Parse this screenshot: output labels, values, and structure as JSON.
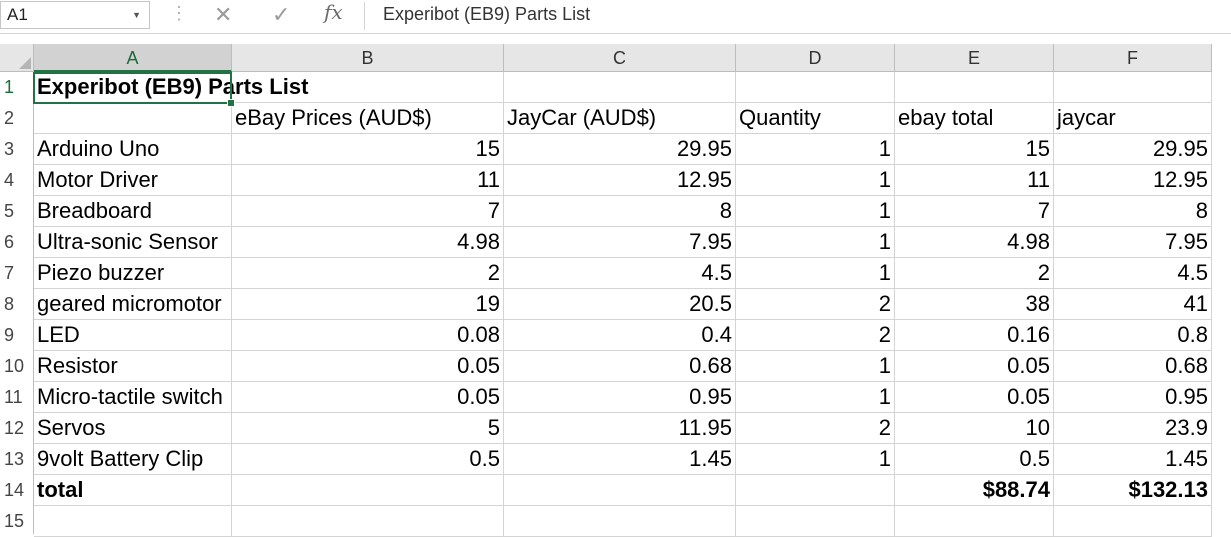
{
  "formula_bar": {
    "name_box": "A1",
    "content": "Experibot (EB9) Parts List",
    "cancel_symbol": "✕",
    "enter_symbol": "✓",
    "fx_label": "fx"
  },
  "columns": [
    "A",
    "B",
    "C",
    "D",
    "E",
    "F"
  ],
  "rows": [
    {
      "num": "1",
      "cells": [
        "Experibot (EB9) Parts List",
        "",
        "",
        "",
        "",
        ""
      ]
    },
    {
      "num": "2",
      "cells": [
        "",
        "eBay Prices (AUD$)",
        "JayCar (AUD$)",
        "Quantity",
        "ebay total",
        "jaycar"
      ]
    },
    {
      "num": "3",
      "cells": [
        "Arduino Uno",
        "15",
        "29.95",
        "1",
        "15",
        "29.95"
      ]
    },
    {
      "num": "4",
      "cells": [
        "Motor Driver",
        "11",
        "12.95",
        "1",
        "11",
        "12.95"
      ]
    },
    {
      "num": "5",
      "cells": [
        "Breadboard",
        "7",
        "8",
        "1",
        "7",
        "8"
      ]
    },
    {
      "num": "6",
      "cells": [
        "Ultra-sonic Sensor",
        "4.98",
        "7.95",
        "1",
        "4.98",
        "7.95"
      ]
    },
    {
      "num": "7",
      "cells": [
        "Piezo buzzer",
        "2",
        "4.5",
        "1",
        "2",
        "4.5"
      ]
    },
    {
      "num": "8",
      "cells": [
        "geared micromotor",
        "19",
        "20.5",
        "2",
        "38",
        "41"
      ]
    },
    {
      "num": "9",
      "cells": [
        "LED",
        "0.08",
        "0.4",
        "2",
        "0.16",
        "0.8"
      ]
    },
    {
      "num": "10",
      "cells": [
        "Resistor",
        "0.05",
        "0.68",
        "1",
        "0.05",
        "0.68"
      ]
    },
    {
      "num": "11",
      "cells": [
        "Micro-tactile switch",
        "0.05",
        "0.95",
        "1",
        "0.05",
        "0.95"
      ]
    },
    {
      "num": "12",
      "cells": [
        "Servos",
        "5",
        "11.95",
        "2",
        "10",
        "23.9"
      ]
    },
    {
      "num": "13",
      "cells": [
        "9volt Battery Clip",
        "0.5",
        "1.45",
        "1",
        "0.5",
        "1.45"
      ]
    },
    {
      "num": "14",
      "cells": [
        "total",
        "",
        "",
        "",
        "$88.74",
        "$132.13"
      ]
    },
    {
      "num": "15",
      "cells": [
        "",
        "",
        "",
        "",
        "",
        ""
      ]
    }
  ],
  "colors": {
    "accent": "#217346",
    "grid": "#d4d4d4",
    "header_bg": "#e6e6e6"
  }
}
